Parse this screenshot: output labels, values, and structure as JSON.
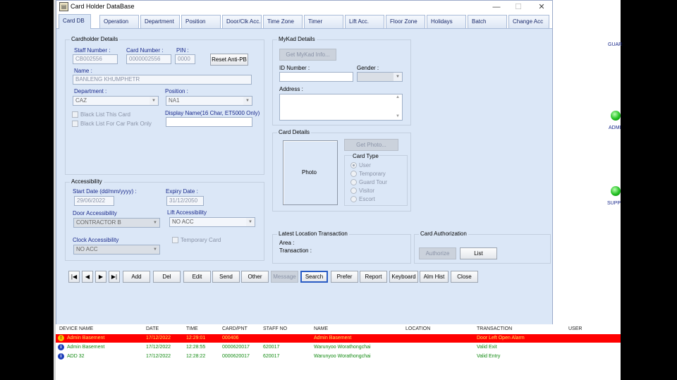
{
  "window": {
    "title": "Card Holder DataBase",
    "minimize": "—",
    "maximize": "☐",
    "close": "✕"
  },
  "tabs": [
    "Card DB",
    "Operation",
    "Department",
    "Position",
    "Door/Clk Acc.",
    "Time Zone",
    "Timer",
    "Lift Acc.",
    "Floor Zone",
    "Holidays",
    "Batch",
    "Change Acc"
  ],
  "cardholder": {
    "group_title": "Cardholder Details",
    "staff_number_label": "Staff Number :",
    "staff_number": "CB002556",
    "card_number_label": "Card Number :",
    "card_number": "0000002556",
    "pin_label": "PIN :",
    "pin": "0000",
    "reset_button": "Reset Anti-PB",
    "name_label": "Name :",
    "name": "BANLENG KHUMPHETR",
    "department_label": "Department :",
    "department": "CAZ",
    "position_label": "Position :",
    "position": "NA1",
    "blacklist_card": "Black List This Card",
    "blacklist_carpark": "Black List For Car Park Only",
    "display_name_label": "Display Name(16 Char, ET5000 Only)",
    "display_name": ""
  },
  "mykad": {
    "group_title": "MyKad Details",
    "get_info_button": "Get MyKad Info...",
    "id_label": "ID Number :",
    "id_value": "",
    "gender_label": "Gender :",
    "gender_value": "",
    "address_label": "Address :",
    "address_value": ""
  },
  "card_details": {
    "group_title": "Card Details",
    "photo_label": "Photo",
    "get_photo_button": "Get Photo...",
    "card_type_label": "Card Type",
    "card_types": [
      "User",
      "Temporary",
      "Guard Tour",
      "Visitor",
      "Escort"
    ],
    "selected": "User"
  },
  "accessibility": {
    "group_title": "Accessibility",
    "start_label": "Start Date (dd/mm/yyyy) :",
    "start": "29/06/2022",
    "expiry_label": "Expiry Date :",
    "expiry": "31/12/2050",
    "door_label": "Door Accessibility",
    "door": "CONTRACTOR B",
    "lift_label": "Lift Accessibility",
    "lift": "NO ACC",
    "clock_label": "Clock Accessibility",
    "clock": "NO ACC",
    "temporary_card": "Temporary Card"
  },
  "latest_location": {
    "group_title": "Latest Location Transaction",
    "area_label": "Area :",
    "transaction_label": "Transaction :"
  },
  "card_authorization": {
    "group_title": "Card Authorization",
    "authorize_button": "Authorize",
    "list_button": "List"
  },
  "nav": {
    "first": "|◀",
    "prev": "◀",
    "next": "▶",
    "last": "▶|"
  },
  "actions": [
    "Add",
    "Del",
    "Edit",
    "Send",
    "Other",
    "Message",
    "Search",
    "Prefer",
    "Report",
    "Keyboard",
    "Alm Hist",
    "Close"
  ],
  "log": {
    "headers": [
      "DEVICE NAME",
      "DATE",
      "TIME",
      "CARD/PNT",
      "STAFF NO",
      "NAME",
      "LOCATION",
      "TRANSACTION",
      "USER"
    ],
    "rows": [
      {
        "icon": "!",
        "device": "Admin Basement",
        "date": "17/12/2022",
        "time": "12:29:01",
        "card": "000406",
        "staff": "",
        "name": "Admin Basement",
        "location": "",
        "transaction": "Door Left Open Alarm",
        "user": "",
        "alarm": true
      },
      {
        "icon": "i",
        "device": "Admin Basement",
        "date": "17/12/2022",
        "time": "12:28:55",
        "card": "0000620017",
        "staff": "620017",
        "name": "Warunyoo Worathongchai",
        "location": "",
        "transaction": "Valid Exit",
        "user": "",
        "alarm": false
      },
      {
        "icon": "i",
        "device": "ADD 32",
        "date": "17/12/2022",
        "time": "12:28:22",
        "card": "0000620017",
        "staff": "620017",
        "name": "Warunyoo Worathongchai",
        "location": "",
        "transaction": "Valid Entry",
        "user": "",
        "alarm": false
      }
    ]
  },
  "backdrop": {
    "label1": "GUAR",
    "label2": "ADMI",
    "label3": "SUPP"
  },
  "colors": {
    "alarm_row": "#ff0000",
    "valid_text": "#118a11",
    "tab_bg": "#dbe7f7"
  }
}
